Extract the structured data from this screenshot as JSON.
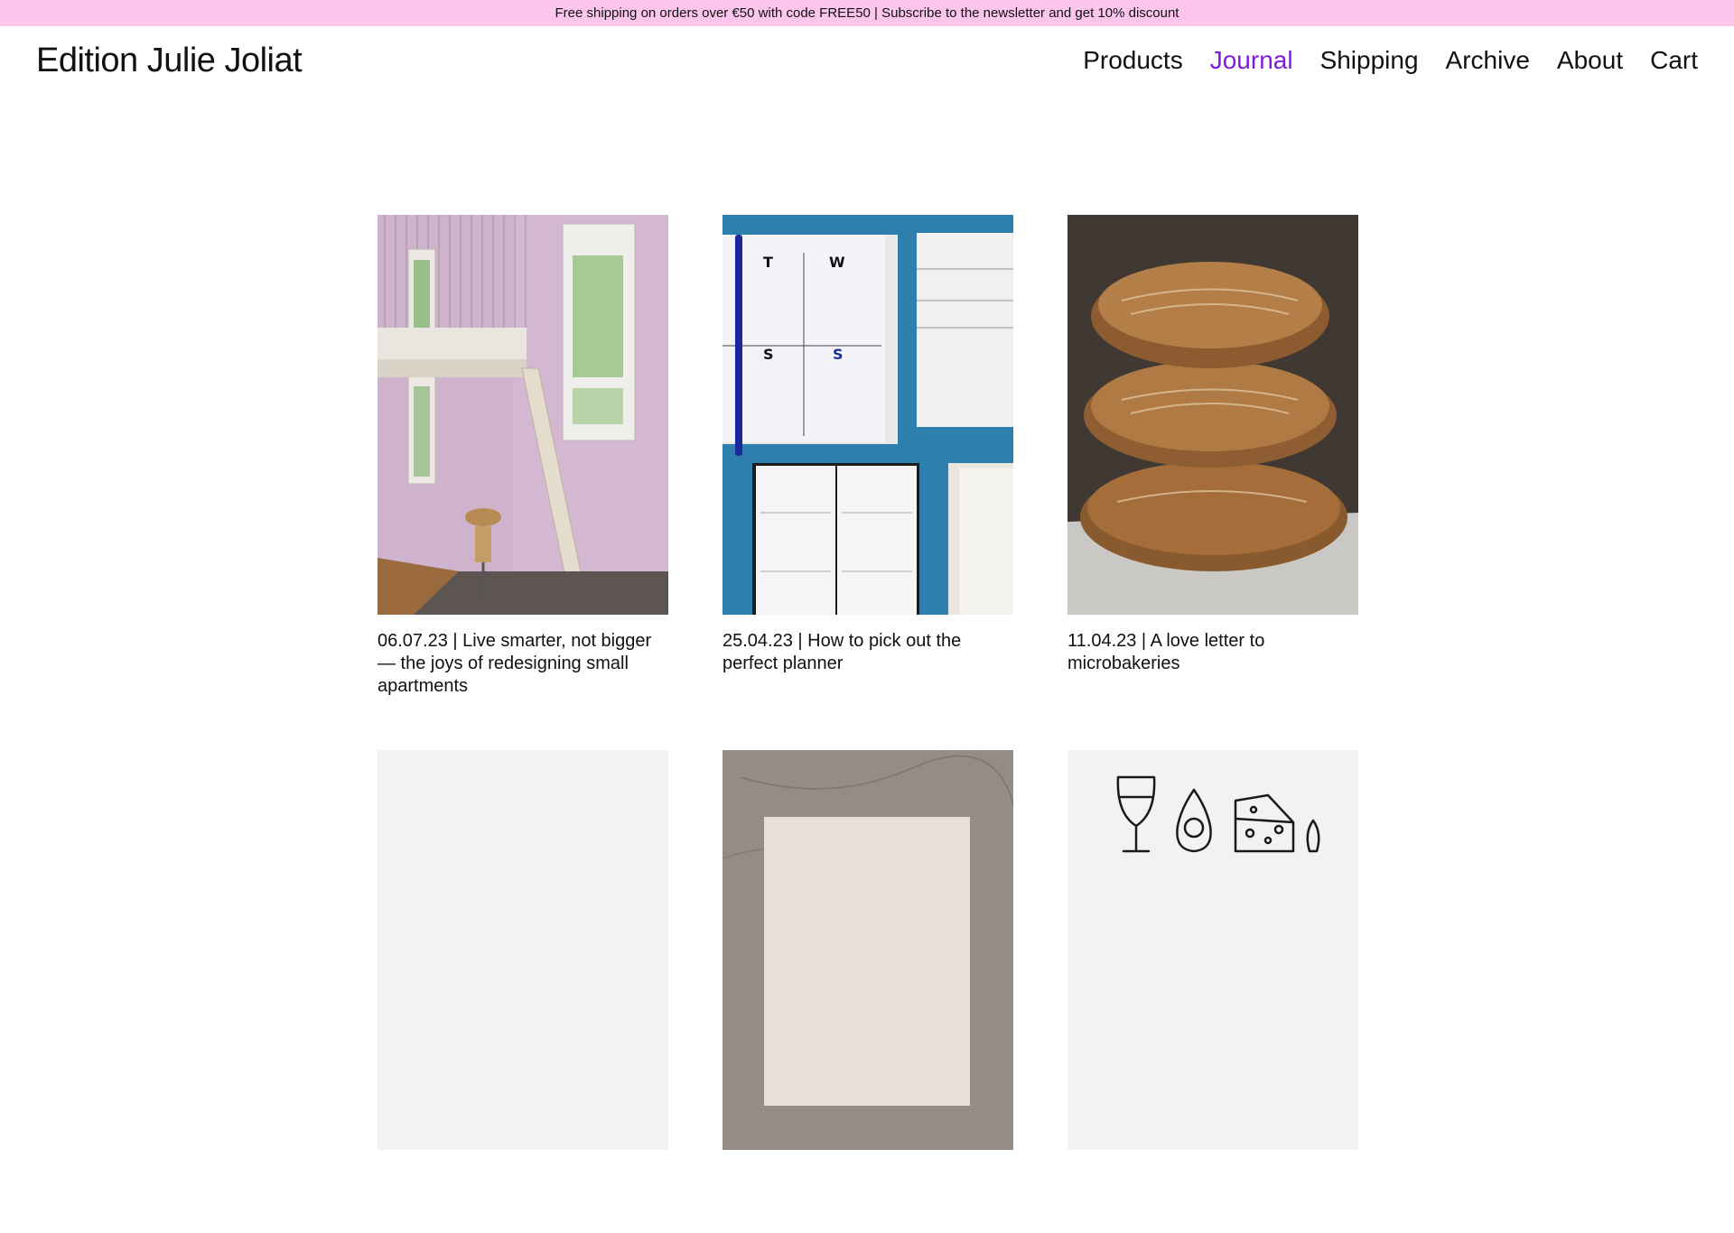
{
  "promo": {
    "text": "Free shipping on orders over €50 with code FREE50 | Subscribe to the newsletter and get 10% discount"
  },
  "header": {
    "logo": "Edition Julie Joliat",
    "nav": [
      {
        "label": "Products",
        "active": false
      },
      {
        "label": "Journal",
        "active": true
      },
      {
        "label": "Shipping",
        "active": false
      },
      {
        "label": "Archive",
        "active": false
      },
      {
        "label": "About",
        "active": false
      },
      {
        "label": "Cart",
        "active": false
      }
    ]
  },
  "colors": {
    "promo_bg": "#fcc5ec",
    "active_nav": "#7d1de0",
    "text": "#111111"
  },
  "posts": [
    {
      "caption": "06.07.23 | Live smarter, not bigger — the joys of redesigning small apartments",
      "image": "loft-bed-room-photo"
    },
    {
      "caption": "25.04.23 | How to pick out the perfect planner",
      "image": "planners-on-blue-photo"
    },
    {
      "caption": "11.04.23 | A love letter to microbakeries",
      "image": "stacked-bread-photo"
    },
    {
      "caption": "",
      "image": "blank-placeholder"
    },
    {
      "caption": "",
      "image": "book-on-concrete-photo"
    },
    {
      "caption": "",
      "image": "food-icons-illustration"
    }
  ]
}
